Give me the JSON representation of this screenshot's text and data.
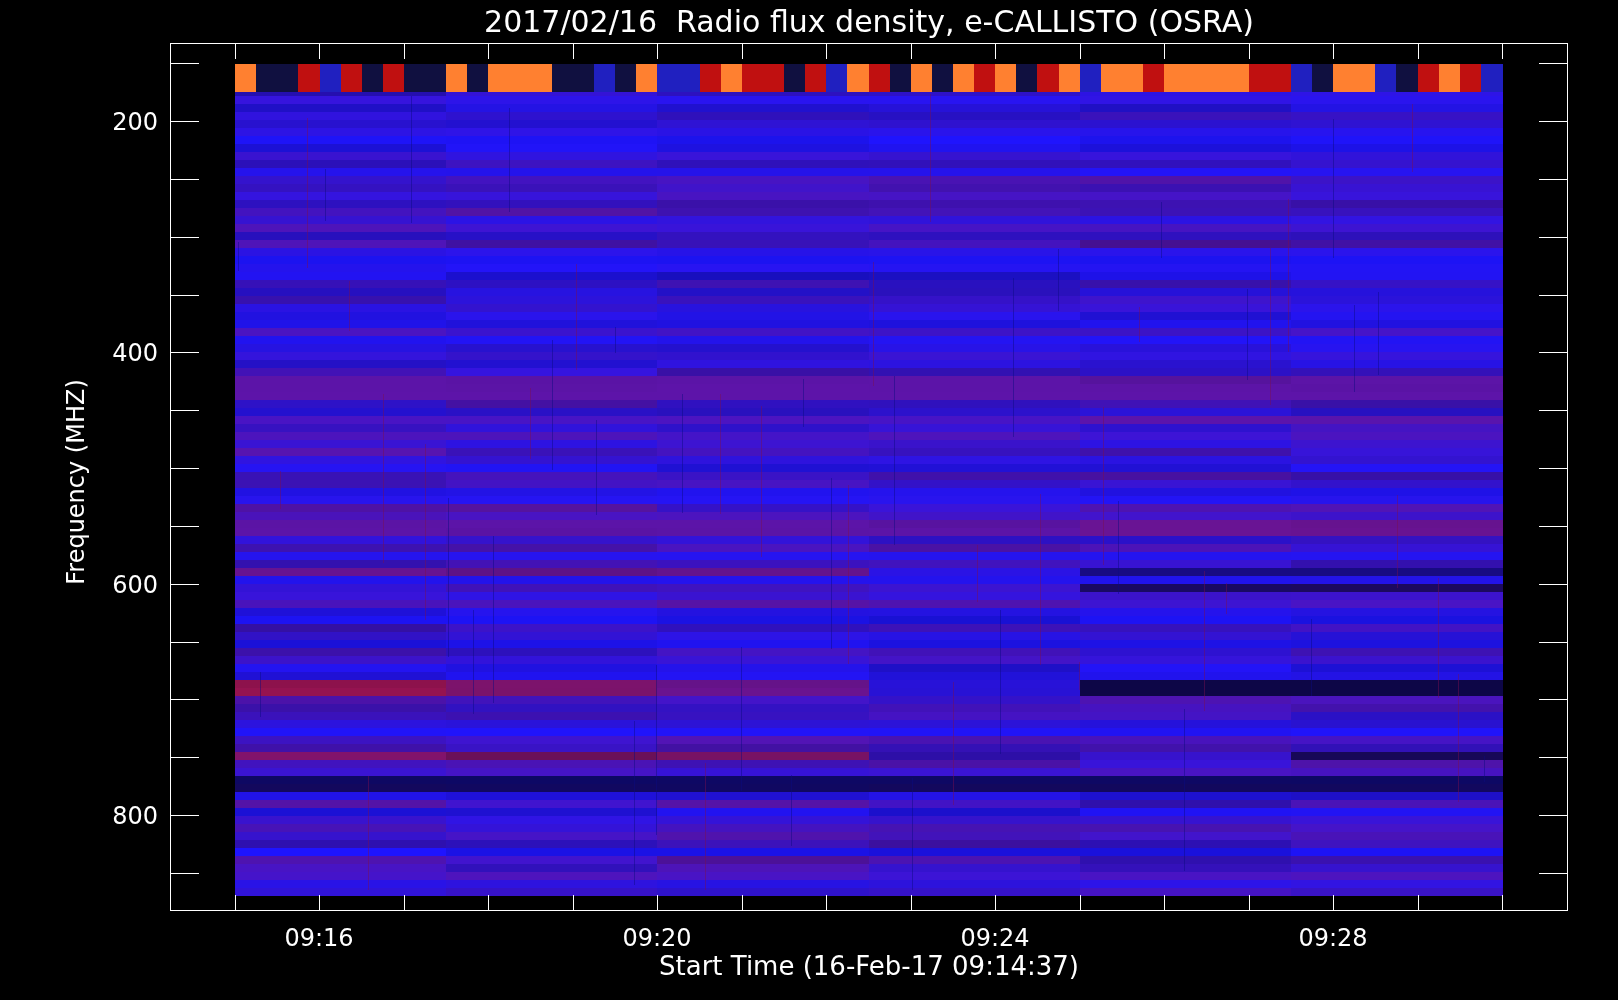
{
  "plot": {
    "title": "2017/02/16  Radio flux density, e-CALLISTO (OSRA)",
    "xlabel": "Start Time (16-Feb-17 09:14:37)",
    "ylabel": "Frequency (MHZ)",
    "xtick_labels": [
      "09:16",
      "09:20",
      "09:24",
      "09:28"
    ],
    "ytick_labels": [
      "200",
      "400",
      "600",
      "800"
    ]
  }
}
